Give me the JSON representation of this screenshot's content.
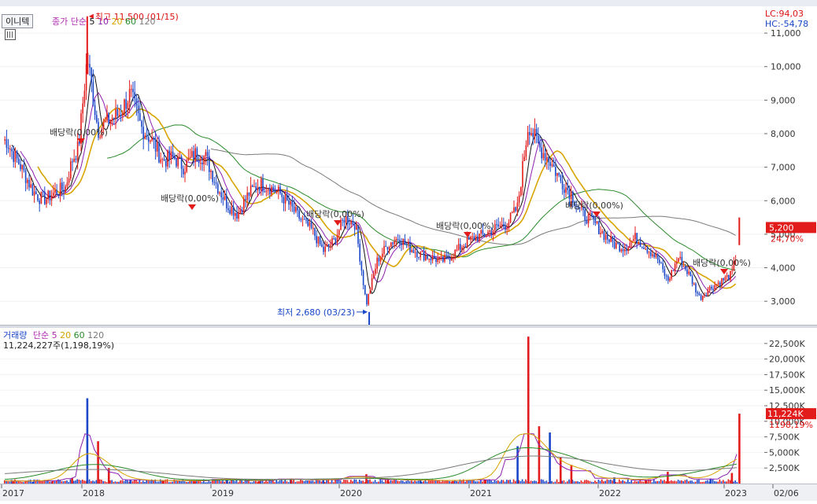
{
  "header": {
    "stock_name": "이니텍",
    "price_legend_label": "종가 단순",
    "ma_periods": [
      "5",
      "10",
      "20",
      "60",
      "120"
    ],
    "lc_label": "LC:94,03",
    "hc_label": "HC:-54,78"
  },
  "volume_header": {
    "label": "거래량",
    "ma_label": "단순",
    "ma_periods": [
      "5",
      "20",
      "60",
      "120"
    ],
    "info_line": "11,224,227주(1,198,19%)"
  },
  "annotations": {
    "high": "최고 11,500 (01/15)",
    "low": "최저 2,680 (03/23)",
    "dividends": [
      "배당락(0,00%)",
      "배당락(0,00%)",
      "배당락(0,00%)",
      "배당락(0,00%)",
      "배당락(0,00%)",
      "배당락(0,00%)"
    ]
  },
  "price_tag": {
    "value": "5,200",
    "change": "24,70%"
  },
  "volume_tag": {
    "value": "11,224K",
    "change": "1198,19%"
  },
  "colors": {
    "up": "#e21b1b",
    "down": "#1a46c8",
    "ma5": "#111111",
    "ma10": "#8e1fb0",
    "ma20": "#d8a400",
    "ma60": "#2a8a2a",
    "ma120": "#7a7a7a"
  },
  "chart_data": [
    {
      "type": "candlestick",
      "title": "",
      "x_ticks": [
        "2017",
        "2018",
        "2019",
        "2020",
        "2021",
        "2022",
        "2023",
        "02/06"
      ],
      "y_ticks": [
        "3,000",
        "4,000",
        "5,000",
        "6,000",
        "7,000",
        "8,000",
        "9,000",
        "10,000",
        "11,000"
      ],
      "ylim": [
        2300,
        11800
      ],
      "highest": {
        "date": "2018-01-15",
        "value": 11500
      },
      "lowest": {
        "date": "2020-03-23",
        "value": 2680
      },
      "last_close": 5200,
      "last_change_pct": 24.7,
      "close_series": [
        [
          "2017-01",
          7800
        ],
        [
          "2017-02",
          7400
        ],
        [
          "2017-03",
          7100
        ],
        [
          "2017-04",
          6700
        ],
        [
          "2017-05",
          6300
        ],
        [
          "2017-06",
          6100
        ],
        [
          "2017-07",
          6050
        ],
        [
          "2017-08",
          6200
        ],
        [
          "2017-09",
          6300
        ],
        [
          "2017-10",
          6400
        ],
        [
          "2017-11",
          7200
        ],
        [
          "2017-12",
          7600
        ],
        [
          "2018-01",
          10300
        ],
        [
          "2018-02",
          8100
        ],
        [
          "2018-03",
          8400
        ],
        [
          "2018-04",
          8600
        ],
        [
          "2018-05",
          9200
        ],
        [
          "2018-06",
          8200
        ],
        [
          "2018-07",
          7800
        ],
        [
          "2018-08",
          7200
        ],
        [
          "2018-09",
          7300
        ],
        [
          "2018-10",
          7000
        ],
        [
          "2018-11",
          7400
        ],
        [
          "2018-12",
          7300
        ],
        [
          "2019-01",
          6500
        ],
        [
          "2019-02",
          5900
        ],
        [
          "2019-03",
          5600
        ],
        [
          "2019-04",
          6200
        ],
        [
          "2019-05",
          6500
        ],
        [
          "2019-06",
          6400
        ],
        [
          "2019-07",
          6200
        ],
        [
          "2019-08",
          5800
        ],
        [
          "2019-09",
          5400
        ],
        [
          "2019-10",
          5100
        ],
        [
          "2019-11",
          4500
        ],
        [
          "2019-12",
          4800
        ],
        [
          "2020-01",
          5500
        ],
        [
          "2020-02",
          5300
        ],
        [
          "2020-03",
          2900
        ],
        [
          "2020-04",
          4200
        ],
        [
          "2020-05",
          4700
        ],
        [
          "2020-06",
          4900
        ],
        [
          "2020-07",
          4600
        ],
        [
          "2020-08",
          4400
        ],
        [
          "2020-09",
          4300
        ],
        [
          "2020-10",
          4200
        ],
        [
          "2020-11",
          4400
        ],
        [
          "2020-12",
          4700
        ],
        [
          "2021-01",
          4900
        ],
        [
          "2021-02",
          5000
        ],
        [
          "2021-03",
          5200
        ],
        [
          "2021-04",
          5300
        ],
        [
          "2021-05",
          5800
        ],
        [
          "2021-06",
          8300
        ],
        [
          "2021-07",
          7600
        ],
        [
          "2021-08",
          7200
        ],
        [
          "2021-09",
          6600
        ],
        [
          "2021-10",
          6200
        ],
        [
          "2021-11",
          5600
        ],
        [
          "2021-12",
          5400
        ],
        [
          "2022-01",
          5000
        ],
        [
          "2022-02",
          4700
        ],
        [
          "2022-03",
          4600
        ],
        [
          "2022-04",
          4900
        ],
        [
          "2022-05",
          4600
        ],
        [
          "2022-06",
          4300
        ],
        [
          "2022-07",
          3600
        ],
        [
          "2022-08",
          4300
        ],
        [
          "2022-09",
          3800
        ],
        [
          "2022-10",
          3100
        ],
        [
          "2022-11",
          3400
        ],
        [
          "2022-12",
          3600
        ],
        [
          "2023-01",
          3800
        ],
        [
          "2023-02",
          5200
        ]
      ],
      "moving_averages": [
        "5",
        "10",
        "20",
        "60",
        "120"
      ]
    },
    {
      "type": "bar",
      "title": "",
      "y_ticks": [
        "2,500K",
        "5,000K",
        "7,500K",
        "10,000K",
        "12,500K",
        "15,000K",
        "17,500K",
        "20,000K",
        "22,500K"
      ],
      "ylim": [
        0,
        24500
      ],
      "unit": "K shares",
      "last_volume": 11224,
      "last_change_pct": 1198.19,
      "volume_series": [
        [
          "2017-Q1",
          300
        ],
        [
          "2017-Q2",
          250
        ],
        [
          "2017-Q3",
          350
        ],
        [
          "2017-Q4",
          900
        ],
        [
          "2018-01",
          13700
        ],
        [
          "2018-02",
          6800
        ],
        [
          "2018-03",
          2500
        ],
        [
          "2018-Q2",
          600
        ],
        [
          "2018-Q3",
          400
        ],
        [
          "2018-Q4",
          350
        ],
        [
          "2019-Q1",
          700
        ],
        [
          "2019-Q2",
          400
        ],
        [
          "2019-Q3",
          800
        ],
        [
          "2019-Q4",
          600
        ],
        [
          "2020-03",
          1500
        ],
        [
          "2020-Q2",
          700
        ],
        [
          "2020-Q3",
          500
        ],
        [
          "2020-Q4",
          400
        ],
        [
          "2021-Q1",
          600
        ],
        [
          "2021-05",
          6000
        ],
        [
          "2021-06",
          23600
        ],
        [
          "2021-07",
          9200
        ],
        [
          "2021-08",
          8200
        ],
        [
          "2021-09",
          4200
        ],
        [
          "2021-10",
          3000
        ],
        [
          "2022-Q1",
          1000
        ],
        [
          "2022-Q2",
          500
        ],
        [
          "2022-07",
          1900
        ],
        [
          "2022-Q4",
          800
        ],
        [
          "2023-01",
          1700
        ],
        [
          "2023-02-06",
          11224
        ]
      ],
      "moving_averages": [
        "5",
        "20",
        "60",
        "120"
      ]
    }
  ]
}
